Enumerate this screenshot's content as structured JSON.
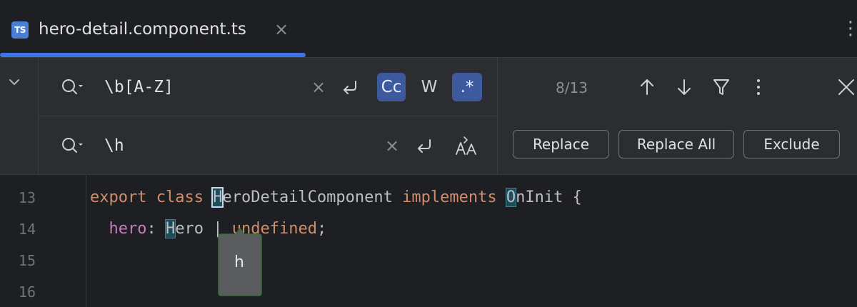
{
  "tab": {
    "badge": "TS",
    "title": "hero-detail.component.ts",
    "close_glyph": "×",
    "more_glyph": "⋮"
  },
  "find": {
    "query": "\\b[A-Z]",
    "clear_glyph": "×",
    "match_case_label": "Cc",
    "whole_words_label": "W",
    "regex_label": ".*",
    "match_case_active": true,
    "whole_words_active": false,
    "regex_active": true,
    "match_count": "8/13"
  },
  "replace": {
    "query": "\\h",
    "clear_glyph": "×",
    "buttons": {
      "replace": "Replace",
      "replace_all": "Replace All",
      "exclude": "Exclude"
    }
  },
  "icons": {
    "expand": "chevron-down-icon",
    "search": "search-icon",
    "newline": "newline-icon",
    "preserve_case": "preserve-case-icon",
    "prev": "arrow-up-icon",
    "next": "arrow-down-icon",
    "filter": "filter-icon",
    "more": "more-vertical-icon",
    "close": "close-icon"
  },
  "colors": {
    "accent": "#3d74e8",
    "active_toggle": "#3d5a9e",
    "keyword": "#cf8e6d",
    "property": "#c77dbb",
    "match_highlight": "#1c4f5b"
  },
  "editor": {
    "line_numbers": [
      "13",
      "14",
      "15",
      "16"
    ],
    "line13": {
      "kw1": "export",
      "kw2": "class",
      "match1": "H",
      "rest1": "eroDetailComponent",
      "kw3": "implements",
      "match2": "O",
      "rest2": "nInit",
      "brace": "{"
    },
    "line14": {
      "prop": "hero",
      "colon": ":",
      "match": "H",
      "rest": "ero",
      "pipe": "|",
      "kw": "undefined",
      "semi": ";"
    },
    "tooltip_text": "h"
  }
}
